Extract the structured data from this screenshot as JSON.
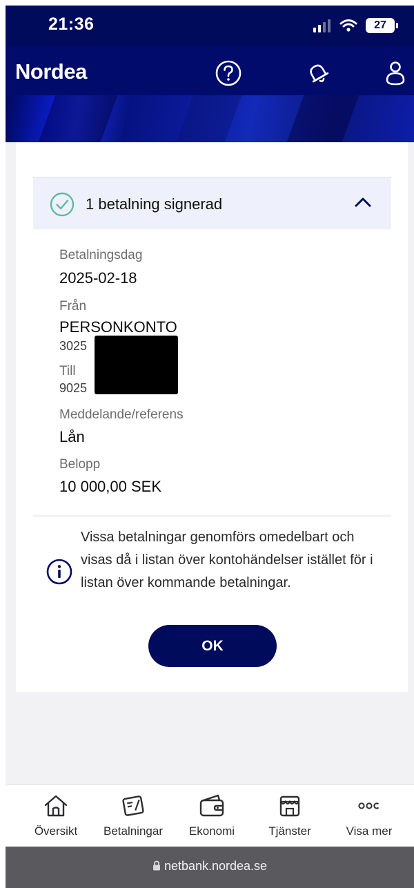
{
  "status_bar": {
    "time": "21:36",
    "battery": "27"
  },
  "header": {
    "logo": "Nordea",
    "icons": [
      "help-icon",
      "bell-icon",
      "profile-icon"
    ]
  },
  "accordion": {
    "title": "1 betalning signerad",
    "icon": "check-circle-icon",
    "toggle_icon": "chevron-up-icon"
  },
  "details": {
    "date_label": "Betalningsdag",
    "date_value": "2025-02-18",
    "from_label": "Från",
    "from_name": "PERSONKONTO",
    "from_account": "3025",
    "to_label": "Till",
    "to_account": "9025",
    "message_label": "Meddelande/referens",
    "message_value": "Lån",
    "amount_label": "Belopp",
    "amount_value": "10 000,00 SEK"
  },
  "info": {
    "icon": "info-icon",
    "text": "Vissa betalningar genomförs omedelbart och visas då i listan över kontohändelser istället för i listan över kommande betalningar."
  },
  "ok_button": {
    "label": "OK"
  },
  "bottom_nav": {
    "items": [
      {
        "label": "Översikt",
        "icon": "home-icon"
      },
      {
        "label": "Betalningar",
        "icon": "payments-icon"
      },
      {
        "label": "Ekonomi",
        "icon": "wallet-icon"
      },
      {
        "label": "Tjänster",
        "icon": "store-icon"
      },
      {
        "label": "Visa mer",
        "icon": "more-icon"
      }
    ]
  },
  "browser": {
    "url": "netbank.nordea.se"
  },
  "colors": {
    "brand_dark": "#000b5c",
    "accent_green": "#5fb8a0",
    "accordion_bg": "#eef1fb"
  }
}
